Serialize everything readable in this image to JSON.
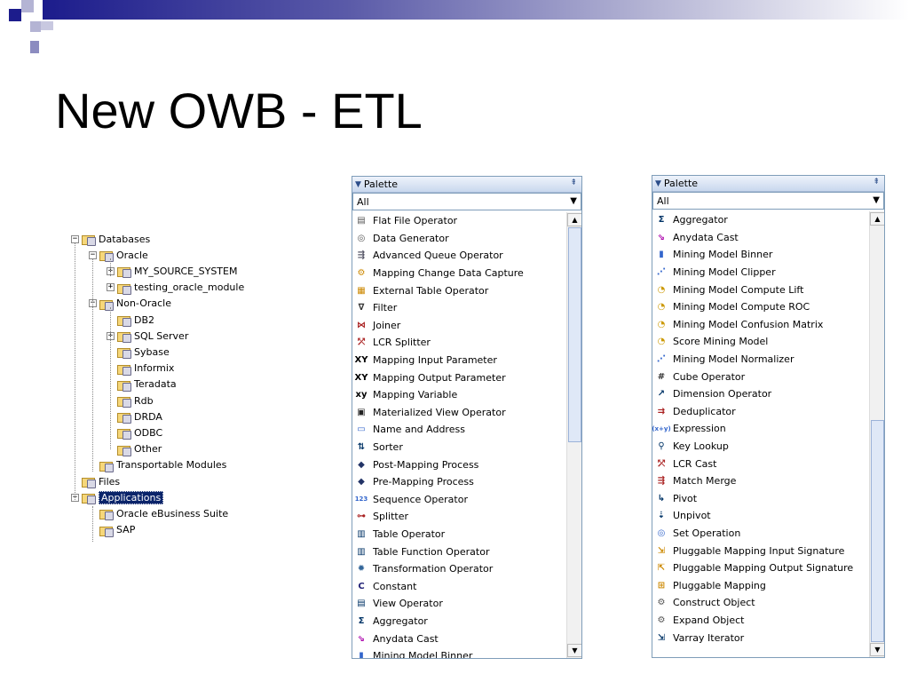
{
  "slide": {
    "title": "New OWB - ETL"
  },
  "colors": {
    "bar_dark": "#1c1c8c",
    "bar_mid": "#5a5aa8",
    "bar_light": "#b4b4d4",
    "selected_bg": "#0a246a"
  },
  "tree": {
    "items": [
      {
        "label": "Databases",
        "level": 0,
        "expander": "minus",
        "selected": false
      },
      {
        "label": "Oracle",
        "level": 1,
        "expander": "minus",
        "selected": false
      },
      {
        "label": "MY_SOURCE_SYSTEM",
        "level": 2,
        "expander": "plus",
        "selected": false
      },
      {
        "label": "testing_oracle_module",
        "level": 2,
        "expander": "plus",
        "selected": false
      },
      {
        "label": "Non-Oracle",
        "level": 1,
        "expander": "minus",
        "selected": false
      },
      {
        "label": "DB2",
        "level": 2,
        "expander": "none",
        "selected": false
      },
      {
        "label": "SQL Server",
        "level": 2,
        "expander": "plus",
        "selected": false
      },
      {
        "label": "Sybase",
        "level": 2,
        "expander": "none",
        "selected": false
      },
      {
        "label": "Informix",
        "level": 2,
        "expander": "none",
        "selected": false
      },
      {
        "label": "Teradata",
        "level": 2,
        "expander": "none",
        "selected": false
      },
      {
        "label": "Rdb",
        "level": 2,
        "expander": "none",
        "selected": false
      },
      {
        "label": "DRDA",
        "level": 2,
        "expander": "none",
        "selected": false
      },
      {
        "label": "ODBC",
        "level": 2,
        "expander": "none",
        "selected": false
      },
      {
        "label": "Other",
        "level": 2,
        "expander": "none",
        "selected": false
      },
      {
        "label": "Transportable Modules",
        "level": 1,
        "expander": "none",
        "selected": false
      },
      {
        "label": "Files",
        "level": 0,
        "expander": "none",
        "selected": false
      },
      {
        "label": "Applications",
        "level": 0,
        "expander": "minus",
        "selected": true
      },
      {
        "label": "Oracle eBusiness Suite",
        "level": 1,
        "expander": "none",
        "selected": false
      },
      {
        "label": "SAP",
        "level": 1,
        "expander": "none",
        "selected": false
      }
    ]
  },
  "palette_left": {
    "header": "Palette",
    "filter": "All",
    "items": [
      {
        "label": "Flat File Operator",
        "icon": "file-icon",
        "glyph": "▤",
        "color": "#555"
      },
      {
        "label": "Data Generator",
        "icon": "generator-icon",
        "glyph": "◎",
        "color": "#555"
      },
      {
        "label": "Advanced Queue Operator",
        "icon": "queue-icon",
        "glyph": "⇶",
        "color": "#556"
      },
      {
        "label": "Mapping Change Data Capture",
        "icon": "cdc-icon",
        "glyph": "⚙",
        "color": "#c80"
      },
      {
        "label": "External Table Operator",
        "icon": "external-table-icon",
        "glyph": "▦",
        "color": "#c80"
      },
      {
        "label": "Filter",
        "icon": "filter-icon",
        "glyph": "∇",
        "color": "#333"
      },
      {
        "label": "Joiner",
        "icon": "joiner-icon",
        "glyph": "⋈",
        "color": "#a22"
      },
      {
        "label": "LCR Splitter",
        "icon": "lcr-splitter-icon",
        "glyph": "⤱",
        "color": "#a22"
      },
      {
        "label": "Mapping Input Parameter",
        "icon": "input-param-icon",
        "glyph": "XY",
        "color": "#000"
      },
      {
        "label": "Mapping Output Parameter",
        "icon": "output-param-icon",
        "glyph": "XY",
        "color": "#000"
      },
      {
        "label": "Mapping Variable",
        "icon": "variable-icon",
        "glyph": "xy",
        "color": "#000"
      },
      {
        "label": "Materialized View Operator",
        "icon": "mview-icon",
        "glyph": "▣",
        "color": "#222"
      },
      {
        "label": "Name and Address",
        "icon": "name-address-icon",
        "glyph": "▭",
        "color": "#36c"
      },
      {
        "label": "Sorter",
        "icon": "sorter-icon",
        "glyph": "⇅",
        "color": "#036"
      },
      {
        "label": "Post-Mapping Process",
        "icon": "post-mapping-icon",
        "glyph": "◆",
        "color": "#236"
      },
      {
        "label": "Pre-Mapping Process",
        "icon": "pre-mapping-icon",
        "glyph": "◆",
        "color": "#236"
      },
      {
        "label": "Sequence Operator",
        "icon": "sequence-icon",
        "glyph": "123",
        "color": "#36c"
      },
      {
        "label": "Splitter",
        "icon": "splitter-icon",
        "glyph": "⊶",
        "color": "#a22"
      },
      {
        "label": "Table Operator",
        "icon": "table-icon",
        "glyph": "▥",
        "color": "#036"
      },
      {
        "label": "Table Function Operator",
        "icon": "table-function-icon",
        "glyph": "▥",
        "color": "#036"
      },
      {
        "label": "Transformation Operator",
        "icon": "transformation-icon",
        "glyph": "✹",
        "color": "#369"
      },
      {
        "label": "Constant",
        "icon": "constant-icon",
        "glyph": "C",
        "color": "#227"
      },
      {
        "label": "View Operator",
        "icon": "view-icon",
        "glyph": "▤",
        "color": "#036"
      },
      {
        "label": "Aggregator",
        "icon": "aggregator-icon",
        "glyph": "Σ",
        "color": "#036"
      },
      {
        "label": "Anydata Cast",
        "icon": "anydata-cast-icon",
        "glyph": "⇘",
        "color": "#a0a"
      },
      {
        "label": "Mining Model Binner",
        "icon": "mining-binner-icon",
        "glyph": "▮",
        "color": "#36c"
      }
    ]
  },
  "palette_right": {
    "header": "Palette",
    "filter": "All",
    "items": [
      {
        "label": "Aggregator",
        "icon": "aggregator-icon",
        "glyph": "Σ",
        "color": "#036"
      },
      {
        "label": "Anydata Cast",
        "icon": "anydata-cast-icon",
        "glyph": "⇘",
        "color": "#a0a"
      },
      {
        "label": "Mining Model Binner",
        "icon": "mining-binner-icon",
        "glyph": "▮",
        "color": "#36c"
      },
      {
        "label": "Mining Model Clipper",
        "icon": "mining-clipper-icon",
        "glyph": "⋰",
        "color": "#36c"
      },
      {
        "label": "Mining Model Compute Lift",
        "icon": "mining-lift-icon",
        "glyph": "◔",
        "color": "#c90"
      },
      {
        "label": "Mining Model Compute ROC",
        "icon": "mining-roc-icon",
        "glyph": "◔",
        "color": "#c90"
      },
      {
        "label": "Mining Model Confusion Matrix",
        "icon": "mining-matrix-icon",
        "glyph": "◔",
        "color": "#c90"
      },
      {
        "label": "Score Mining Model",
        "icon": "score-mining-icon",
        "glyph": "◔",
        "color": "#c90"
      },
      {
        "label": "Mining Model Normalizer",
        "icon": "mining-normalizer-icon",
        "glyph": "⋰",
        "color": "#36c"
      },
      {
        "label": "Cube Operator",
        "icon": "cube-icon",
        "glyph": "#",
        "color": "#333"
      },
      {
        "label": "Dimension Operator",
        "icon": "dimension-icon",
        "glyph": "↗",
        "color": "#036"
      },
      {
        "label": "Deduplicator",
        "icon": "deduplicator-icon",
        "glyph": "⇉",
        "color": "#a22"
      },
      {
        "label": "Expression",
        "icon": "expression-icon",
        "glyph": "(x+y)",
        "color": "#36c"
      },
      {
        "label": "Key Lookup",
        "icon": "key-lookup-icon",
        "glyph": "⚲",
        "color": "#036"
      },
      {
        "label": "LCR Cast",
        "icon": "lcr-cast-icon",
        "glyph": "⤱",
        "color": "#a22"
      },
      {
        "label": "Match Merge",
        "icon": "match-merge-icon",
        "glyph": "⇶",
        "color": "#a22"
      },
      {
        "label": "Pivot",
        "icon": "pivot-icon",
        "glyph": "↳",
        "color": "#036"
      },
      {
        "label": "Unpivot",
        "icon": "unpivot-icon",
        "glyph": "⇣",
        "color": "#036"
      },
      {
        "label": "Set Operation",
        "icon": "set-operation-icon",
        "glyph": "◎",
        "color": "#36c"
      },
      {
        "label": "Pluggable Mapping Input Signature",
        "icon": "input-signature-icon",
        "glyph": "⇲",
        "color": "#c80"
      },
      {
        "label": "Pluggable Mapping Output Signature",
        "icon": "output-signature-icon",
        "glyph": "⇱",
        "color": "#c80"
      },
      {
        "label": "Pluggable Mapping",
        "icon": "pluggable-mapping-icon",
        "glyph": "⊞",
        "color": "#c80"
      },
      {
        "label": "Construct Object",
        "icon": "construct-object-icon",
        "glyph": "⚙",
        "color": "#555"
      },
      {
        "label": "Expand Object",
        "icon": "expand-object-icon",
        "glyph": "⚙",
        "color": "#555"
      },
      {
        "label": "Varray Iterator",
        "icon": "varray-iterator-icon",
        "glyph": "⇲",
        "color": "#036"
      }
    ]
  }
}
